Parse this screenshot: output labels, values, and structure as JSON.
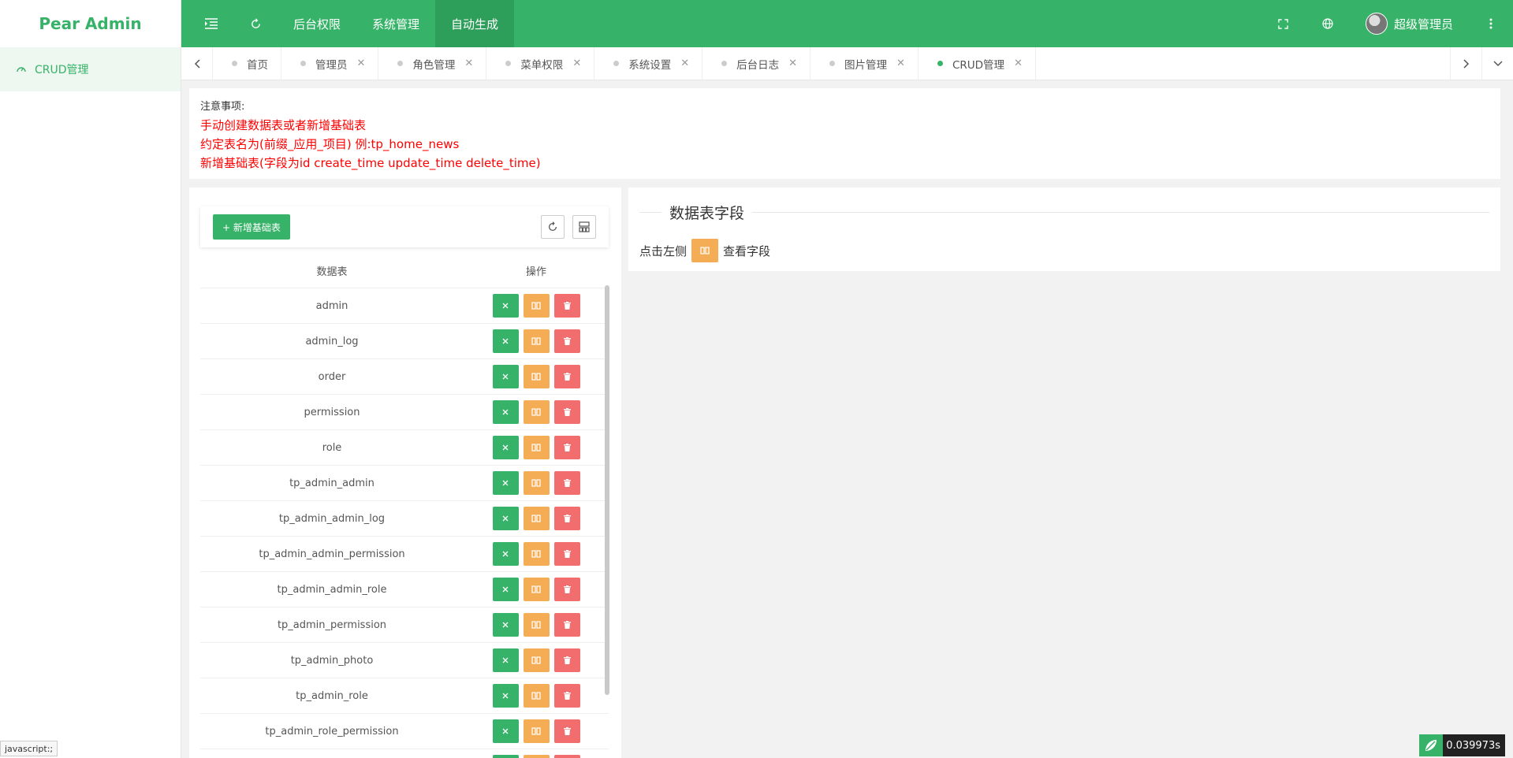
{
  "app": {
    "title": "Pear Admin"
  },
  "sidebar": {
    "items": [
      {
        "label": "CRUD管理",
        "icon": "dashboard-icon"
      }
    ]
  },
  "header": {
    "nav": [
      {
        "label": "后台权限",
        "active": false
      },
      {
        "label": "系统管理",
        "active": false
      },
      {
        "label": "自动生成",
        "active": true
      }
    ],
    "user_name": "超级管理员"
  },
  "tabs": [
    {
      "label": "首页",
      "closable": false,
      "active": false
    },
    {
      "label": "管理员",
      "closable": true,
      "active": false
    },
    {
      "label": "角色管理",
      "closable": true,
      "active": false
    },
    {
      "label": "菜单权限",
      "closable": true,
      "active": false
    },
    {
      "label": "系统设置",
      "closable": true,
      "active": false
    },
    {
      "label": "后台日志",
      "closable": true,
      "active": false
    },
    {
      "label": "图片管理",
      "closable": true,
      "active": false
    },
    {
      "label": "CRUD管理",
      "closable": true,
      "active": true
    }
  ],
  "notice": {
    "title": "注意事项:",
    "lines": [
      "手动创建数据表或者新增基础表",
      "约定表名为(前缀_应用_项目) 例:tp_home_news",
      "新增基础表(字段为id create_time update_time delete_time)"
    ]
  },
  "toolbar": {
    "add_label": "+ 新增基础表"
  },
  "table": {
    "col_name": "数据表",
    "col_op": "操作",
    "rows": [
      "admin",
      "admin_log",
      "order",
      "permission",
      "role",
      "tp_admin_admin",
      "tp_admin_admin_log",
      "tp_admin_admin_permission",
      "tp_admin_admin_role",
      "tp_admin_permission",
      "tp_admin_photo",
      "tp_admin_role",
      "tp_admin_role_permission",
      ""
    ]
  },
  "fields_panel": {
    "title": "数据表字段",
    "hint_before": "点击左侧",
    "hint_after": "查看字段"
  },
  "status": {
    "link_preview": "javascript:;",
    "timer": "0.039973s"
  },
  "colors": {
    "primary": "#36b368",
    "warning": "#f5ad55",
    "danger": "#f26d6d",
    "notice_text": "#ff0000"
  }
}
